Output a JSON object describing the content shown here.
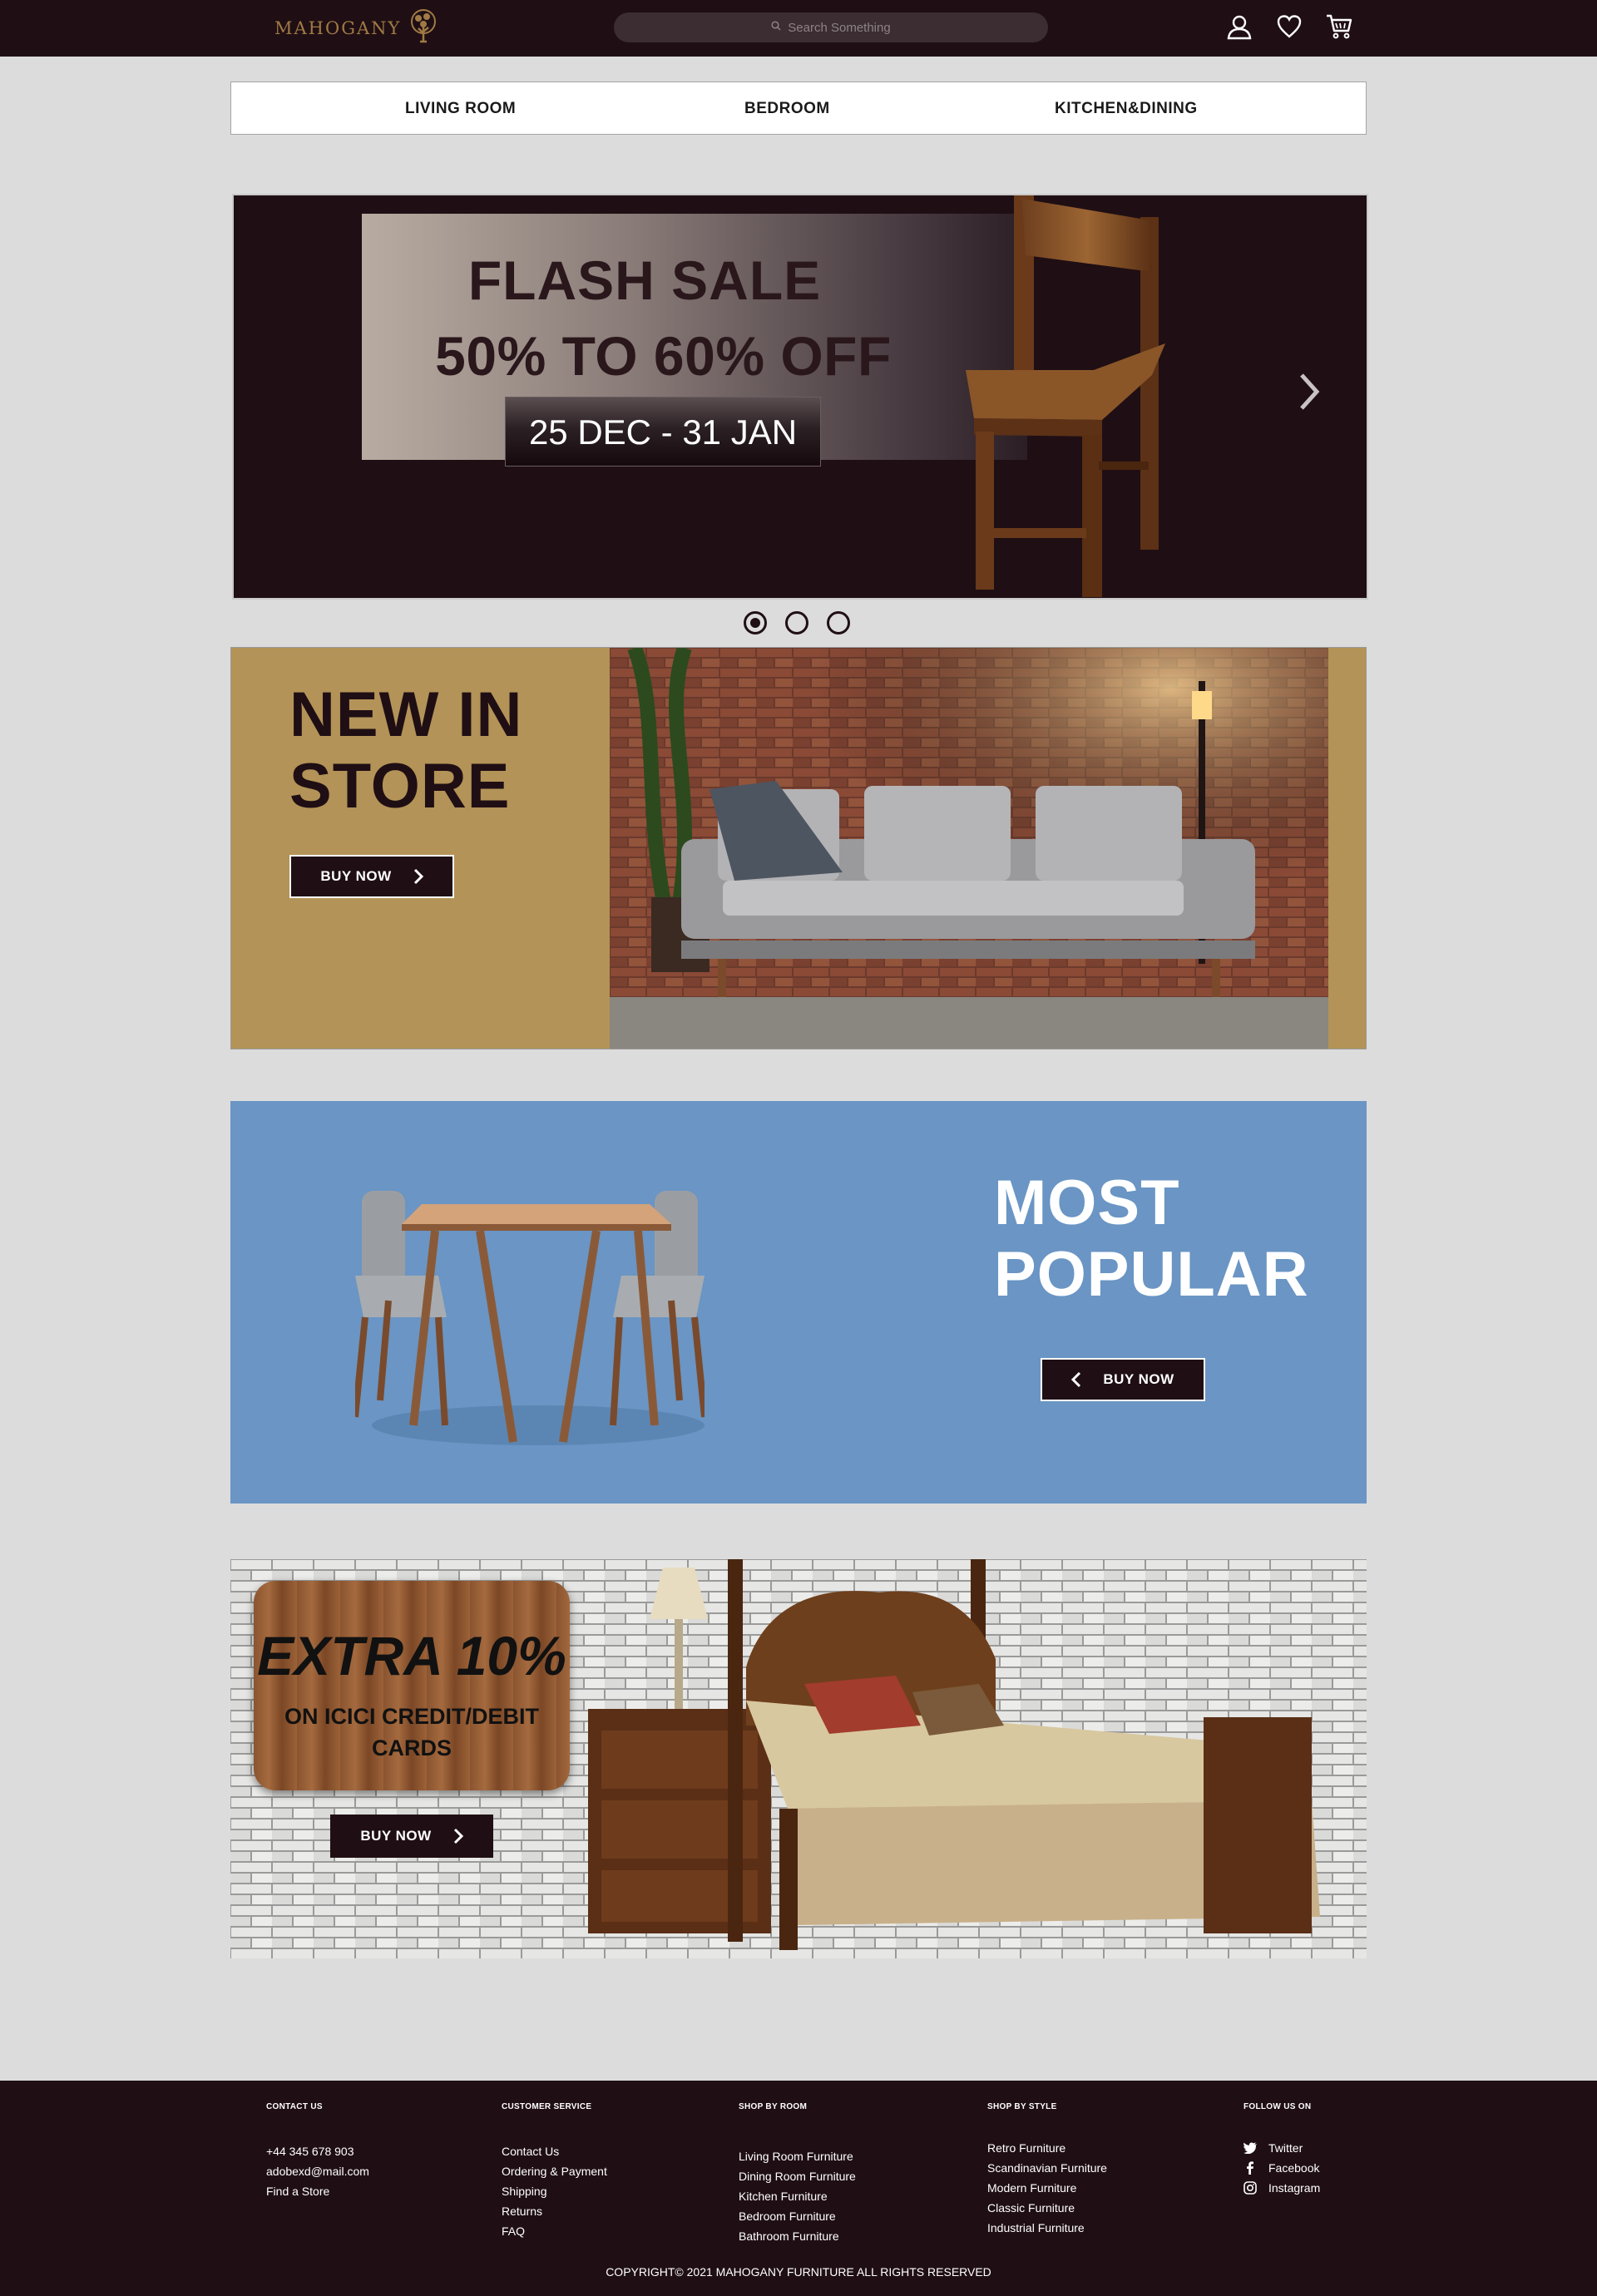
{
  "header": {
    "logo_text": "MAHOGANY",
    "search_placeholder": "Search Something",
    "icons": [
      "user-icon",
      "heart-icon",
      "cart-icon"
    ]
  },
  "categories": [
    "LIVING ROOM",
    "BEDROOM",
    "KITCHEN&DINING"
  ],
  "hero": {
    "line1": "FLASH SALE",
    "line2": "50% TO 60% OFF",
    "date": "25 DEC - 31 JAN",
    "slides": 3,
    "active_slide": 1
  },
  "new_in_store": {
    "title_line1": "NEW IN",
    "title_line2": "STORE",
    "button": "BUY NOW"
  },
  "most_popular": {
    "title_line1": "MOST",
    "title_line2": "POPULAR",
    "button": "BUY NOW"
  },
  "extra_offer": {
    "title": "EXTRA 10%",
    "sub_line1": "ON ICICI CREDIT/DEBIT",
    "sub_line2": "CARDS",
    "button": "BUY NOW"
  },
  "footer": {
    "contact": {
      "heading": "CONTACT US",
      "items": [
        "+44 345 678 903",
        "adobexd@mail.com",
        "Find a Store"
      ]
    },
    "customer_service": {
      "heading": "CUSTOMER SERVICE",
      "items": [
        "Contact Us",
        "Ordering & Payment",
        "Shipping",
        "Returns",
        "FAQ"
      ]
    },
    "shop_by_room": {
      "heading": "SHOP BY ROOM",
      "items": [
        "Living Room Furniture",
        "Dining Room Furniture",
        "Kitchen Furniture",
        "Bedroom Furniture",
        "Bathroom Furniture"
      ]
    },
    "shop_by_style": {
      "heading": "SHOP BY STYLE",
      "items": [
        "Retro Furniture",
        "Scandinavian Furniture",
        "Modern Furniture",
        "Classic Furniture",
        "Industrial Furniture"
      ]
    },
    "follow": {
      "heading": "FOLLOW US ON",
      "items": [
        "Twitter",
        "Facebook",
        "Instagram"
      ]
    },
    "copyright": "COPYRIGHT© 2021 MAHOGANY FURNITURE ALL RIGHTS RESERVED"
  },
  "colors": {
    "dark": "#1f0f14",
    "gold": "#b39357",
    "blue": "#6a95c4",
    "bg": "#dcdcdc"
  }
}
